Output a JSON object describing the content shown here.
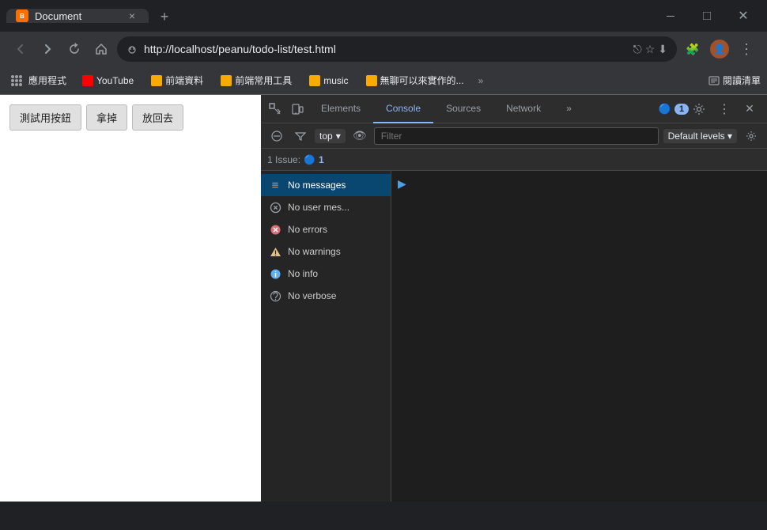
{
  "titlebar": {
    "tab_title": "Document",
    "favicon_text": "B",
    "close_tab": "×",
    "new_tab": "+",
    "minimize": "—",
    "maximize": "□",
    "close_window": "✕"
  },
  "navbar": {
    "back": "←",
    "forward": "→",
    "reload": "↻",
    "home": "⌂",
    "url": "http://localhost/peanu/todo-list/test.html",
    "share": "⎋",
    "bookmark": "☆",
    "profile_icon": "👤",
    "more": "⋮",
    "extensions": "🧩"
  },
  "bookmarks": {
    "apps_label": "應用程式",
    "items": [
      {
        "label": "YouTube",
        "color": "#ff0000"
      },
      {
        "label": "前端資料",
        "color": "#f9ab00"
      },
      {
        "label": "前端常用工具",
        "color": "#f9ab00"
      },
      {
        "label": "music",
        "color": "#f9ab00"
      },
      {
        "label": "無聊可以來實作的...",
        "color": "#f9ab00"
      }
    ],
    "more": "»",
    "reader_mode": "閱讀清單"
  },
  "page": {
    "btn1": "測試用按鈕",
    "btn2": "拿掉",
    "btn3": "放回去"
  },
  "devtools": {
    "tabs": [
      {
        "label": "Elements",
        "active": false
      },
      {
        "label": "Console",
        "active": true
      },
      {
        "label": "Sources",
        "active": false
      },
      {
        "label": "Network",
        "active": false
      }
    ],
    "more_tabs": "»",
    "issue_count": "1",
    "issue_badge": "1",
    "settings_icon": "⚙",
    "more_icon": "⋮",
    "close_icon": "✕",
    "inspect_icon": "⬚",
    "device_icon": "📱"
  },
  "console_toolbar": {
    "clear": "🚫",
    "context": "top",
    "context_arrow": "▾",
    "eye": "👁",
    "filter_placeholder": "Filter",
    "levels": "Default levels",
    "levels_arrow": "▾",
    "settings": "⚙"
  },
  "issues_bar": {
    "label": "1 Issue:",
    "icon": "🔵",
    "count": "1"
  },
  "console_sidebar": {
    "items": [
      {
        "icon": "≡",
        "label": "No messages",
        "icon_color": "#9aa0a6",
        "active": true
      },
      {
        "icon": "⊘",
        "label": "No user mes...",
        "icon_color": "#9aa0a6"
      },
      {
        "icon": "⊗",
        "label": "No errors",
        "icon_color": "#e06c75"
      },
      {
        "icon": "⚠",
        "label": "No warnings",
        "icon_color": "#e5c07b"
      },
      {
        "icon": "ℹ",
        "label": "No info",
        "icon_color": "#61afef"
      },
      {
        "icon": "⚙",
        "label": "No verbose",
        "icon_color": "#9aa0a6"
      }
    ]
  },
  "console_main": {
    "expand_arrow": "▶"
  }
}
